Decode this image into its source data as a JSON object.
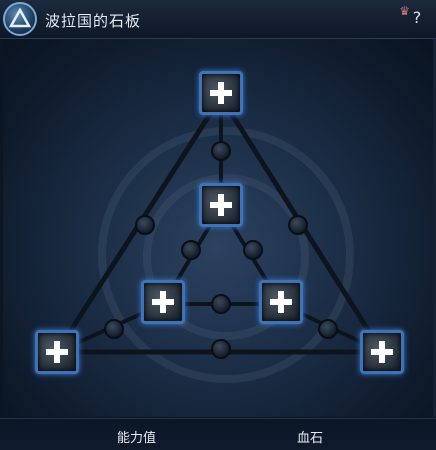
{
  "window": {
    "title": "波拉国的石板",
    "help_label": "?",
    "crown_icon": "crown-icon"
  },
  "board": {
    "slots": [
      {
        "name": "top"
      },
      {
        "name": "center-upper"
      },
      {
        "name": "center-left"
      },
      {
        "name": "center-right"
      },
      {
        "name": "bottom-left"
      },
      {
        "name": "bottom-right"
      }
    ],
    "accent_color": "#3f73b7"
  },
  "footer": {
    "tabs": [
      {
        "label": "能力值"
      },
      {
        "label": "血石"
      }
    ]
  }
}
